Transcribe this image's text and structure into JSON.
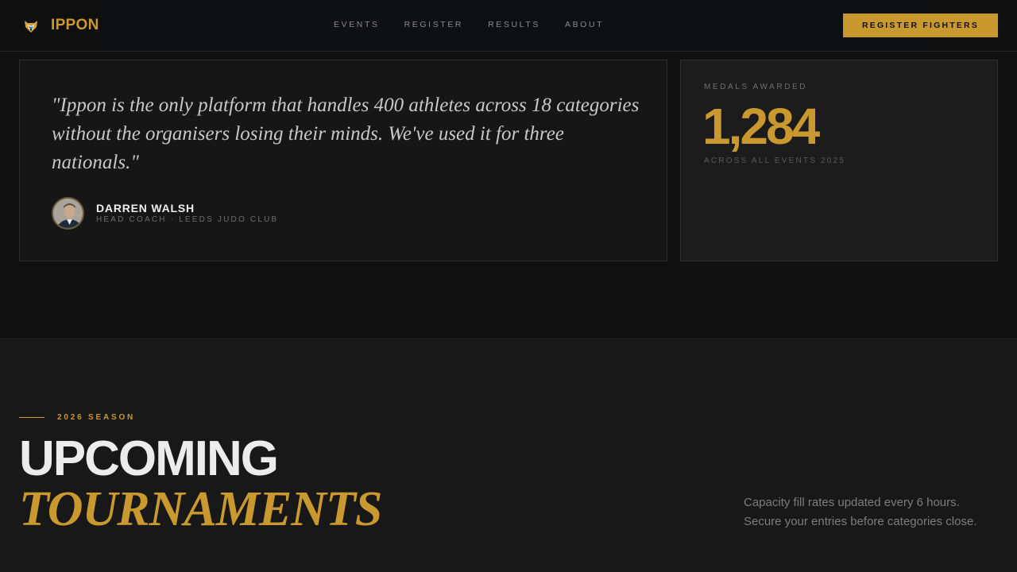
{
  "brand": {
    "name": "IPPON",
    "logo_icon": "fox-head-icon"
  },
  "nav": {
    "links": [
      "EVENTS",
      "REGISTER",
      "RESULTS",
      "ABOUT"
    ],
    "cta_label": "REGISTER FIGHTERS"
  },
  "testimonial": {
    "quote": "\"Ippon is the only platform that handles 400 athletes across 18 categories without the organisers losing their minds. We've used it for three nationals.\"",
    "author_name": "DARREN WALSH",
    "author_role": "HEAD COACH · LEEDS JUDO CLUB"
  },
  "stats": {
    "label": "MEDALS AWARDED",
    "value": "1,284",
    "caption": "ACROSS ALL EVENTS 2025"
  },
  "section": {
    "eyebrow": "2026 SEASON",
    "title_line1": "UPCOMING",
    "title_line2": "TOURNAMENTS",
    "note": "Capacity fill rates updated every 6 hours. Secure your entries before categories close."
  },
  "colors": {
    "accent": "#c9982f",
    "background": "#111111",
    "card": "#161616"
  }
}
